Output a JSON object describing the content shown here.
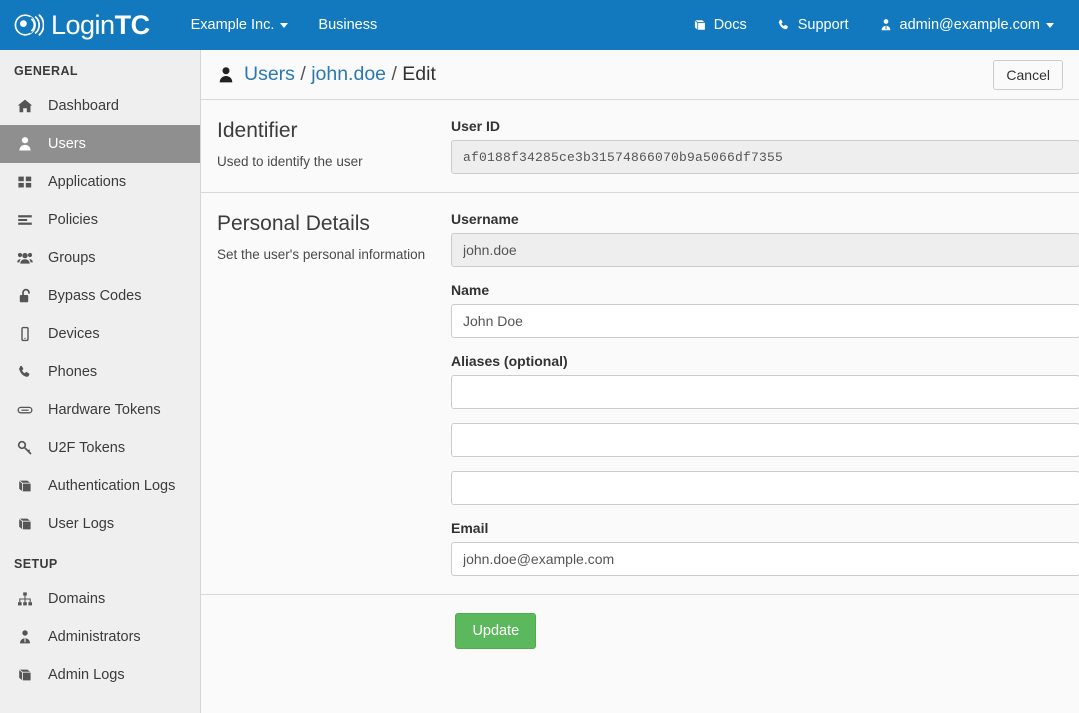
{
  "navbar": {
    "brand_prefix": "Login",
    "brand_suffix": "TC",
    "brand_logo_icon": "logintc-signal-logo-icon",
    "org_switcher": "Example Inc.",
    "plan": "Business",
    "docs": "Docs",
    "docs_icon": "book-icon",
    "support": "Support",
    "support_icon": "phone-icon",
    "account": "admin@example.com",
    "account_icon": "user-tie-icon",
    "brand_color": "#1279bf"
  },
  "sidebar": {
    "groups": [
      {
        "heading": "GENERAL",
        "items": [
          {
            "label": "Dashboard",
            "icon": "home-icon",
            "active": false
          },
          {
            "label": "Users",
            "icon": "user-icon",
            "active": true
          },
          {
            "label": "Applications",
            "icon": "grid-icon",
            "active": false
          },
          {
            "label": "Policies",
            "icon": "list-icon",
            "active": false
          },
          {
            "label": "Groups",
            "icon": "users-icon",
            "active": false
          },
          {
            "label": "Bypass Codes",
            "icon": "unlock-icon",
            "active": false
          },
          {
            "label": "Devices",
            "icon": "mobile-icon",
            "active": false
          },
          {
            "label": "Phones",
            "icon": "phone-icon",
            "active": false
          },
          {
            "label": "Hardware Tokens",
            "icon": "hardware-token-icon",
            "active": false
          },
          {
            "label": "U2F Tokens",
            "icon": "key-icon",
            "active": false
          },
          {
            "label": "Authentication Logs",
            "icon": "book-icon",
            "active": false
          },
          {
            "label": "User Logs",
            "icon": "book-icon",
            "active": false
          }
        ]
      },
      {
        "heading": "SETUP",
        "items": [
          {
            "label": "Domains",
            "icon": "sitemap-icon",
            "active": false
          },
          {
            "label": "Administrators",
            "icon": "user-tie-icon",
            "active": false
          },
          {
            "label": "Admin Logs",
            "icon": "book-icon",
            "active": false
          }
        ]
      }
    ],
    "active_color": "#8f8f8f",
    "background": "#efefef"
  },
  "page": {
    "breadcrumb_icon": "user-icon",
    "crumb_root": "Users",
    "crumb_user": "john.doe",
    "crumb_current": "Edit",
    "sep": "/",
    "cancel_label": "Cancel"
  },
  "identifier_section": {
    "title": "Identifier",
    "description": "Used to identify the user",
    "user_id_label": "User ID",
    "user_id_value": "af0188f34285ce3b31574866070b9a5066df7355"
  },
  "personal_section": {
    "title": "Personal Details",
    "description": "Set the user's personal information",
    "username_label": "Username",
    "username_value": "john.doe",
    "name_label": "Name",
    "name_value": "John Doe",
    "aliases_label": "Aliases (optional)",
    "alias1_value": "",
    "alias2_value": "",
    "alias3_value": "",
    "alias_placeholder": "",
    "email_label": "Email",
    "email_value": "john.doe@example.com"
  },
  "footer": {
    "update_label": "Update",
    "update_color": "#5cb85c"
  }
}
